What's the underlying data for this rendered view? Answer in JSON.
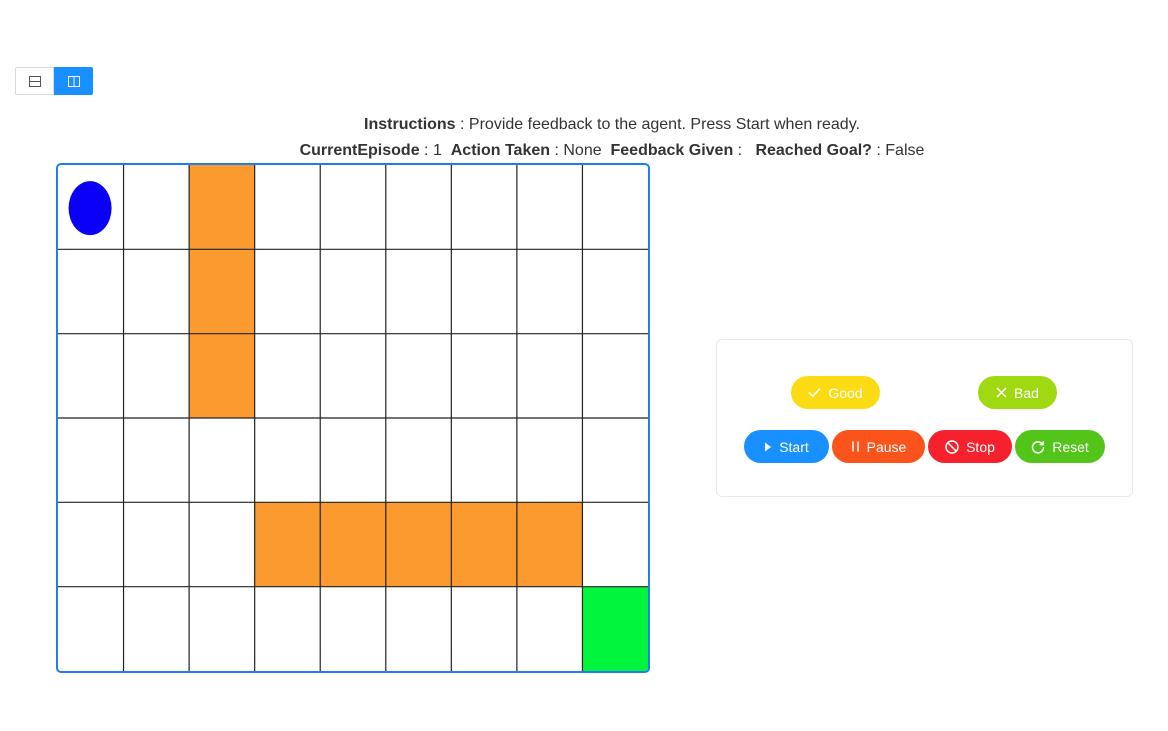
{
  "layout_toggle": {
    "items": [
      {
        "icon": "rows-layout-icon",
        "active": false
      },
      {
        "icon": "columns-layout-icon",
        "active": true
      }
    ]
  },
  "instructions": {
    "label": "Instructions",
    "separator": " : ",
    "text": "Provide feedback to the agent. Press Start when ready."
  },
  "status": {
    "episode_label": "CurrentEpisode",
    "episode_value": "1",
    "action_label": "Action Taken",
    "action_value": "None",
    "feedback_label": "Feedback Given",
    "feedback_value": "",
    "goal_label": "Reached Goal?",
    "goal_value": "False"
  },
  "grid": {
    "cols": 9,
    "rows": 6,
    "agent": {
      "row": 0,
      "col": 0
    },
    "obstacles": [
      {
        "row": 0,
        "col": 2
      },
      {
        "row": 1,
        "col": 2
      },
      {
        "row": 2,
        "col": 2
      },
      {
        "row": 4,
        "col": 3
      },
      {
        "row": 4,
        "col": 4
      },
      {
        "row": 4,
        "col": 5
      },
      {
        "row": 4,
        "col": 6
      },
      {
        "row": 4,
        "col": 7
      }
    ],
    "goal": {
      "row": 5,
      "col": 8
    },
    "colors": {
      "agent": "#0a00f5",
      "obstacle": "#fb9a2e",
      "goal": "#00f53c",
      "line": "#222222",
      "border": "#1e7ef0"
    }
  },
  "controls": {
    "good": {
      "label": "Good",
      "icon": "check-icon",
      "color": "#fadb14"
    },
    "bad": {
      "label": "Bad",
      "icon": "close-icon",
      "color": "#a0d911"
    },
    "start": {
      "label": "Start",
      "icon": "play-icon",
      "color": "#1890ff"
    },
    "pause": {
      "label": "Pause",
      "icon": "pause-icon",
      "color": "#fa541c"
    },
    "stop": {
      "label": "Stop",
      "icon": "stop-icon",
      "color": "#f5222d"
    },
    "reset": {
      "label": "Reset",
      "icon": "reset-icon",
      "color": "#52c41a"
    }
  }
}
